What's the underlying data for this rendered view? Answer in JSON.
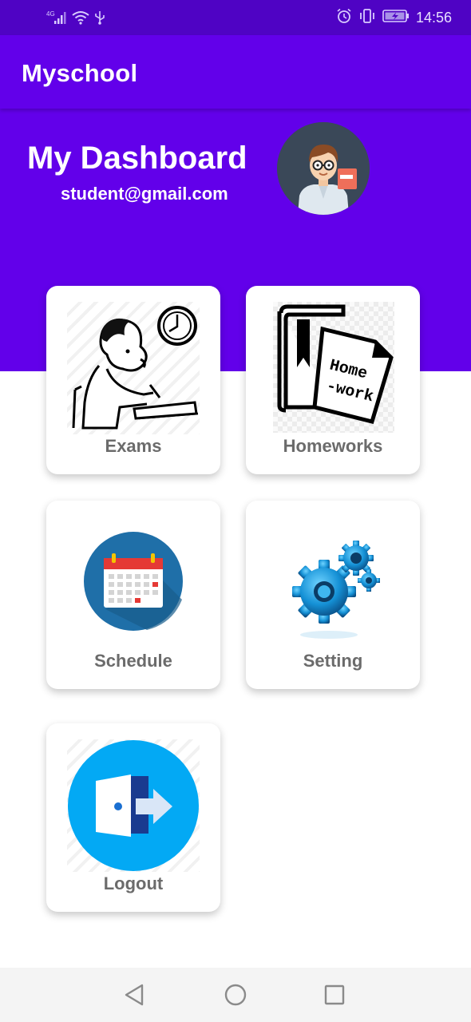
{
  "status_bar": {
    "network_label": "4G",
    "time": "14:56",
    "icons": [
      "signal-icon",
      "wifi-icon",
      "usb-icon",
      "alarm-icon",
      "vibrate-icon",
      "battery-icon"
    ]
  },
  "app_bar": {
    "title": "Myschool"
  },
  "header": {
    "title": "My Dashboard",
    "email": "student@gmail.com"
  },
  "cards": [
    {
      "label": "Exams",
      "icon": "exam-drawing-icon"
    },
    {
      "label": "Homeworks",
      "icon": "homework-book-icon"
    },
    {
      "label": "Schedule",
      "icon": "calendar-icon"
    },
    {
      "label": "Setting",
      "icon": "gears-icon"
    },
    {
      "label": "Logout",
      "icon": "logout-door-icon"
    }
  ],
  "homework_image_text": [
    "Home",
    "-work"
  ],
  "nav_bar": {
    "icons": [
      "back-icon",
      "home-icon",
      "recents-icon"
    ]
  },
  "colors": {
    "status_bar": "#4f03c4",
    "primary": "#6200ea",
    "card_label": "#6b6b6b",
    "nav_bar": "#f4f4f4"
  }
}
